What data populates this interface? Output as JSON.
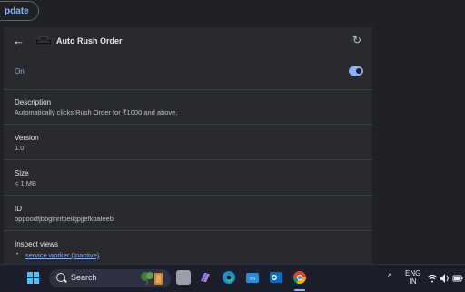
{
  "topbar": {
    "update_label": "pdate"
  },
  "header": {
    "back_icon": "arrow-left-icon",
    "title": "Auto Rush Order",
    "reload_icon": "reload-icon"
  },
  "toggle_row": {
    "label": "On",
    "state": "on"
  },
  "description": {
    "label": "Description",
    "value": "Automatically clicks Rush Order for ₹1000 and above."
  },
  "version": {
    "label": "Version",
    "value": "1.0"
  },
  "size": {
    "label": "Size",
    "value": "< 1 MB"
  },
  "id": {
    "label": "ID",
    "value": "oppoodfjbbglnnfpeikjpjjefkbaleeb"
  },
  "inspect": {
    "label": "Inspect views",
    "link": "service worker (Inactive)"
  },
  "taskbar": {
    "search_placeholder": "Search",
    "tray_lang": "ENG",
    "tray_region": "IN",
    "icons": [
      "windows-start-icon",
      "search-icon",
      "task-view-icon",
      "copilot-icon",
      "edge-icon",
      "store-icon",
      "outlook-icon",
      "chrome-icon",
      "chevron-up-icon",
      "wifi-icon",
      "volume-icon",
      "battery-icon"
    ]
  },
  "colors": {
    "accent": "#8ab4f8",
    "panel": "#292a2d",
    "background": "#202124",
    "taskbar": "#1c1f2b"
  }
}
